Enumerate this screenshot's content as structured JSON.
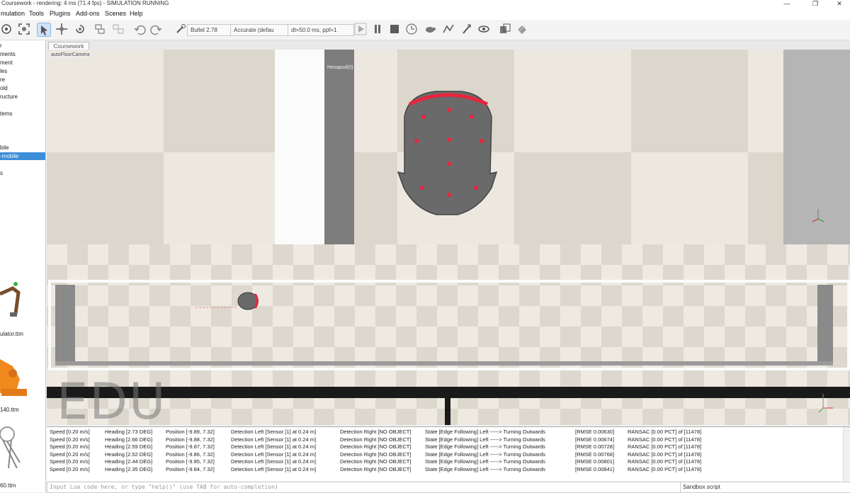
{
  "window": {
    "title": "Coursework - rendering: 4 ms (71.4 fps) - SIMULATION RUNNING",
    "controls": [
      "—",
      "❐",
      "✕"
    ]
  },
  "menu": [
    "mulation",
    "Tools",
    "Plugins",
    "Add-ons",
    "Scenes",
    "Help"
  ],
  "toolbar": {
    "engine": "Bullet 2.78",
    "accuracy": "Accurate (defau",
    "timestep": "dt=50.0 ms, ppf=1",
    "icons": [
      "camera-pan-icon",
      "camera-fit-icon",
      "object-select-icon",
      "object-move-icon",
      "object-rotate-icon",
      "assemble-icon",
      "disassemble-icon",
      "undo-icon",
      "redo-icon",
      "play-icon",
      "pause-icon",
      "stop-icon",
      "realtime-icon",
      "threaded-icon",
      "dynamics-icon",
      "visualization-icon",
      "page-icon",
      "layer-icon"
    ]
  },
  "scene_tree": {
    "items": [
      "r",
      "ments",
      "ment",
      "les",
      "re",
      "old",
      "ructure",
      "tems",
      "bile",
      "-mobile",
      "s"
    ],
    "selected_index": 9
  },
  "model_browser": {
    "labels": [
      "ulator.ttm",
      "140.ttm",
      "60.ttm"
    ]
  },
  "tab": {
    "label": "Coursework"
  },
  "viewport": {
    "camera_label": "autoFloorCamera",
    "sensor_label": "Hexapod(0)",
    "watermark": "EDU"
  },
  "console": {
    "rows": [
      {
        "speed": "Speed [0.20 m/s]",
        "heading": "Heading [2.73 DEG]",
        "position": "Position [-9.89, 7.32]",
        "det_left": "Detection Left [Sensor [1] at 0.24 m]",
        "det_right": "Detection Right [NO OBJECT]",
        "state": "State [Edge Following] Left -----> Turning Outwards",
        "rmse": "[RMSE 0.00630]",
        "ransac": "RANSAC [0.00 PCT] of [11478]"
      },
      {
        "speed": "Speed [0.20 m/s]",
        "heading": "Heading [2.66 DEG]",
        "position": "Position [-9.88, 7.32]",
        "det_left": "Detection Left [Sensor [1] at 0.24 m]",
        "det_right": "Detection Right [NO OBJECT]",
        "state": "State [Edge Following] Left -----> Turning Outwards",
        "rmse": "[RMSE 0.00674]",
        "ransac": "RANSAC [0.00 PCT] of [11478]"
      },
      {
        "speed": "Speed [0.20 m/s]",
        "heading": "Heading [2.59 DEG]",
        "position": "Position [-9.87, 7.32]",
        "det_left": "Detection Left [Sensor [1] at 0.24 m]",
        "det_right": "Detection Right [NO OBJECT]",
        "state": "State [Edge Following] Left -----> Turning Outwards",
        "rmse": "[RMSE 0.00728]",
        "ransac": "RANSAC [0.00 PCT] of [11478]"
      },
      {
        "speed": "Speed [0.20 m/s]",
        "heading": "Heading [2.52 DEG]",
        "position": "Position [-9.86, 7.32]",
        "det_left": "Detection Left [Sensor [1] at 0.24 m]",
        "det_right": "Detection Right [NO OBJECT]",
        "state": "State [Edge Following] Left -----> Turning Outwards",
        "rmse": "[RMSE 0.00768]",
        "ransac": "RANSAC [0.00 PCT] of [11478]"
      },
      {
        "speed": "Speed [0.20 m/s]",
        "heading": "Heading [2.44 DEG]",
        "position": "Position [-9.85, 7.32]",
        "det_left": "Detection Left [Sensor [1] at 0.24 m]",
        "det_right": "Detection Right [NO OBJECT]",
        "state": "State [Edge Following] Left -----> Turning Outwards",
        "rmse": "[RMSE 0.00801]",
        "ransac": "RANSAC [0.00 PCT] of [11478]"
      },
      {
        "speed": "Speed [0.20 m/s]",
        "heading": "Heading [2.35 DEG]",
        "position": "Position [-9.84, 7.32]",
        "det_left": "Detection Left [Sensor [1] at 0.24 m]",
        "det_right": "Detection Right [NO OBJECT]",
        "state": "State [Edge Following] Left -----> Turning Outwards",
        "rmse": "[RMSE 0.00841]",
        "ransac": "RANSAC [0.00 PCT] of [11478]"
      }
    ],
    "input_placeholder": "Input Lua code here, or type \"help()\" (use TAB for auto-completion)",
    "script_selector": "Sandbox script"
  },
  "colors": {
    "selection": "#3d8ed8",
    "robot_body": "#6a6a6a",
    "sensor_dot": "#e8253d",
    "wall_dark": "#1a1a1a"
  }
}
